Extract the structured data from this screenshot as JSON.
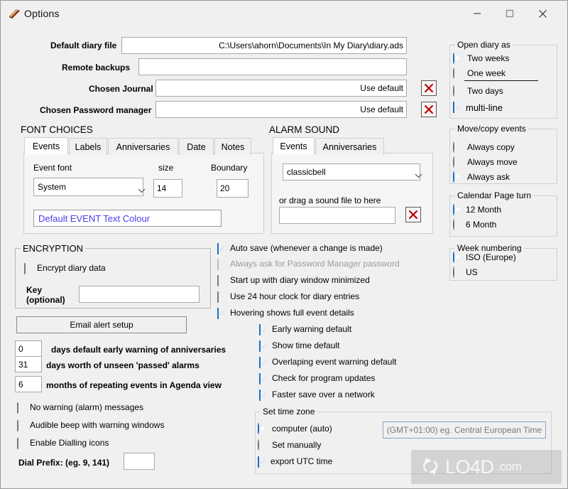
{
  "window": {
    "title": "Options",
    "icon": "book-icon",
    "minimize": "–",
    "maximize": "□",
    "close": "×"
  },
  "top_fields": [
    {
      "label": "Default diary file",
      "value": "C:\\Users\\ahorn\\Documents\\In My Diary\\diary.ads",
      "clear": false
    },
    {
      "label": "Remote backups",
      "value": "",
      "clear": false
    },
    {
      "label": "Chosen Journal",
      "value": "Use default",
      "clear": true
    },
    {
      "label": "Chosen Password manager",
      "value": "Use default",
      "clear": true
    }
  ],
  "clear_button_icon": "red-x-icon",
  "font_choices": {
    "title": "FONT CHOICES",
    "tabs": [
      "Events",
      "Labels",
      "Anniversaries",
      "Date",
      "Notes"
    ],
    "selected_tab": "Events",
    "font_label": "Event font",
    "font_value": "System",
    "size_label": "size",
    "size_value": "14",
    "boundary_label": "Boundary",
    "boundary_value": "20",
    "colour_text": "Default EVENT Text Colour",
    "colour_hex": "#4b3cf0"
  },
  "alarm_sound": {
    "title": "ALARM SOUND",
    "tabs": [
      "Events",
      "Anniversaries"
    ],
    "selected_tab": "Events",
    "sound_value": "classicbell",
    "drag_label": "or drag a sound file to here",
    "drag_value": "",
    "clear_icon": "red-x-icon"
  },
  "encryption": {
    "title": "ENCRYPTION",
    "encrypt_label": "Encrypt diary data",
    "encrypt_checked": false,
    "key_label_line1": "Key",
    "key_label_line2": "(optional)",
    "key_value": ""
  },
  "email_alert_button": "Email alert setup",
  "numeric_rows": [
    {
      "value": "0",
      "label": "days default early warning of anniversaries"
    },
    {
      "value": "31",
      "label": "days worth of unseen 'passed' alarms"
    },
    {
      "value": "6",
      "label": "months of repeating events in Agenda view"
    }
  ],
  "bottom_left_checks": [
    {
      "label": "No warning (alarm) messages",
      "checked": false
    },
    {
      "label": "Audible beep with warning windows",
      "checked": false
    },
    {
      "label": "Enable Dialling icons",
      "checked": false
    }
  ],
  "dial_prefix": {
    "label": "Dial Prefix: (eg. 9, 141)",
    "value": ""
  },
  "middle_checks": [
    {
      "label": "Auto save (whenever a change is made)",
      "checked": true,
      "disabled": false,
      "indent": 0
    },
    {
      "label": "Always ask for Password Manager password",
      "checked": true,
      "disabled": true,
      "indent": 0
    },
    {
      "label": "Start up with diary window minimized",
      "checked": false,
      "disabled": false,
      "indent": 0
    },
    {
      "label": "Use 24 hour clock for diary entries",
      "checked": false,
      "disabled": false,
      "indent": 0
    },
    {
      "label": "Hovering shows full event details",
      "checked": true,
      "disabled": false,
      "indent": 0
    },
    {
      "label": "Early warning default",
      "checked": true,
      "disabled": false,
      "indent": 1
    },
    {
      "label": "Show time default",
      "checked": true,
      "disabled": false,
      "indent": 1
    },
    {
      "label": "Overlaping event warning default",
      "checked": true,
      "disabled": false,
      "indent": 1
    },
    {
      "label": "Check for program updates",
      "checked": true,
      "disabled": false,
      "indent": 1
    },
    {
      "label": "Faster save over a network",
      "checked": true,
      "disabled": false,
      "indent": 1
    }
  ],
  "time_zone": {
    "title": "Set time zone",
    "options": [
      {
        "label": "computer (auto)",
        "selected": true
      },
      {
        "label": "Set manually",
        "selected": false
      }
    ],
    "export_utc": {
      "label": "export UTC time",
      "checked": true
    },
    "zone_value": "(GMT+01:00) eg. Central European Time"
  },
  "open_diary_as": {
    "title": "Open diary as",
    "options": [
      {
        "label": "Two weeks",
        "selected": true
      },
      {
        "label": "One week",
        "selected": false
      },
      {
        "label": "Two days",
        "selected": false
      }
    ],
    "multiline": {
      "label": "multi-line",
      "checked": true
    }
  },
  "move_copy": {
    "title": "Move/copy events",
    "options": [
      {
        "label": "Always copy",
        "selected": false
      },
      {
        "label": "Always move",
        "selected": false
      },
      {
        "label": "Always ask",
        "selected": true
      }
    ]
  },
  "page_turn": {
    "title": "Calendar Page turn",
    "options": [
      {
        "label": "12 Month",
        "selected": true
      },
      {
        "label": "6 Month",
        "selected": false
      }
    ]
  },
  "week_numbering": {
    "title": "Week numbering",
    "options": [
      {
        "label": "ISO (Europe)",
        "selected": true
      },
      {
        "label": "US",
        "selected": false
      }
    ]
  },
  "watermark": {
    "main": "LO4D",
    "suffix": ".com",
    "icon": "refresh-icon"
  },
  "colors": {
    "accent": "#1a6fc4",
    "clear_x": "#c00000",
    "link_text": "#4b3cf0"
  }
}
